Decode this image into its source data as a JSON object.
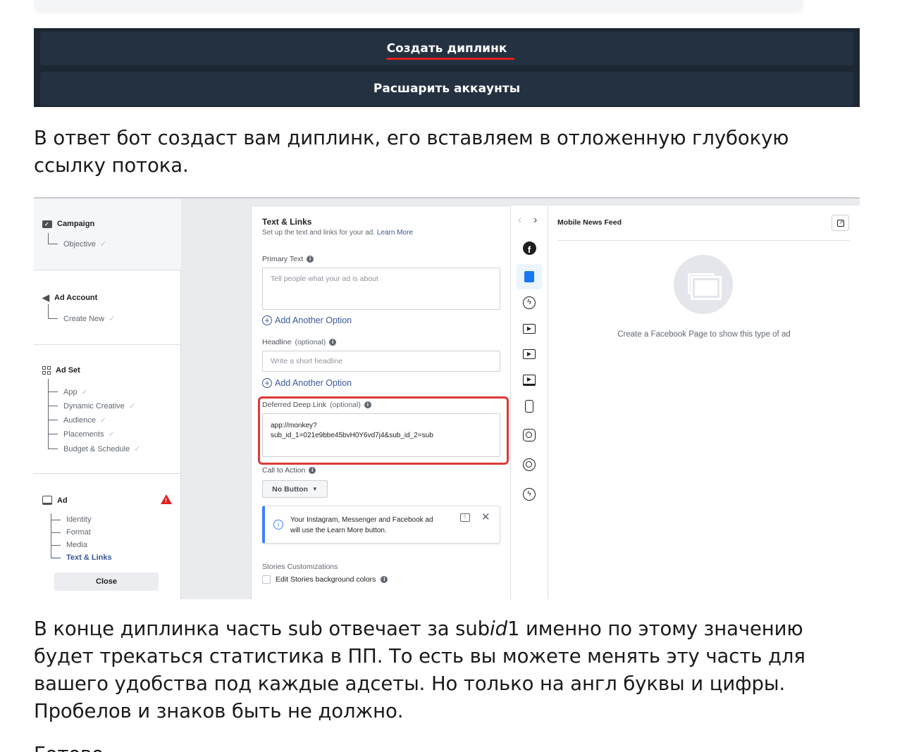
{
  "telegram": {
    "buttons": [
      "Создать диплинк",
      "Расшарить аккаунты"
    ],
    "accent_underline_color": "#e0201b"
  },
  "paragraph1": "В ответ бот создаст вам диплинк, его вставляем в отложенную глубокую ссылку потока.",
  "ads": {
    "sidebar": {
      "campaign": {
        "title": "Campaign",
        "items": [
          "Objective"
        ]
      },
      "ad_account": {
        "title": "Ad Account",
        "items": [
          "Create New"
        ]
      },
      "ad_set": {
        "title": "Ad Set",
        "items": [
          "App",
          "Dynamic Creative",
          "Audience",
          "Placements",
          "Budget & Schedule"
        ]
      },
      "ad": {
        "title": "Ad",
        "items": [
          "Identity",
          "Format",
          "Media",
          "Text & Links"
        ],
        "warning_icon": "warning-icon"
      },
      "close_label": "Close"
    },
    "form": {
      "title": "Text & Links",
      "subtitle": "Set up the text and links for your ad.",
      "learn_more": "Learn More",
      "primary_text_label": "Primary Text",
      "primary_text_placeholder": "Tell people what your ad is about",
      "add_option": "Add Another Option",
      "headline_label": "Headline",
      "optional": "(optional)",
      "headline_placeholder": "Write a short headline",
      "deep_link_label": "Deferred Deep Link",
      "deep_link_value_line1": "app://monkey?",
      "deep_link_value_line2": "sub_id_1=021e9bbe45bvH0Y6vd7j4&sub_id_2=sub",
      "cta_label": "Call to Action",
      "cta_value": "No Button",
      "notice_line1": "Your Instagram, Messenger and Facebook ad",
      "notice_line2": "will use the Learn More button.",
      "stories_title": "Stories Customizations",
      "stories_checkbox": "Edit Stories background colors"
    },
    "preview": {
      "title": "Mobile News Feed",
      "message": "Create a Facebook Page to show this type of ad"
    }
  },
  "paragraph2_part1": "В конце диплинка часть sub отвечает за sub",
  "paragraph2_italic": "id",
  "paragraph2_part2": "1 именно по этому значению будет трекаться статистика в ПП. То есть вы можете менять эту часть для вашего удобства под каждые адсеты. Но только на англ буквы и цифры. Пробелов и знаков быть не должно.",
  "paragraph3_partial": "Готово"
}
